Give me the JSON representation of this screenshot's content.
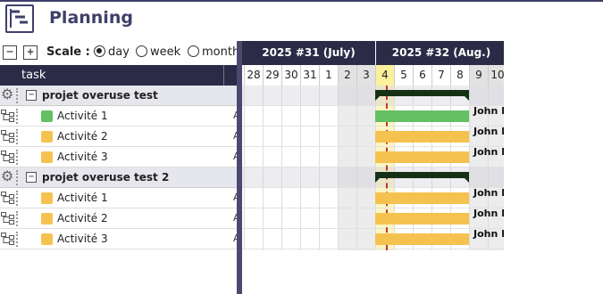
{
  "app": {
    "title": "Planning"
  },
  "toolbar": {
    "expand_minus": "−",
    "expand_plus": "+",
    "scale_label": "Scale :",
    "scale_options": [
      {
        "label": "day",
        "selected": true
      },
      {
        "label": "week",
        "selected": false
      },
      {
        "label": "month",
        "selected": false
      }
    ]
  },
  "grid": {
    "task_header": "task",
    "rows": [
      {
        "type": "group",
        "label": "projet overuse test",
        "col2": ""
      },
      {
        "type": "task",
        "label": "Activité 1",
        "color": "#63c063",
        "col2": "A"
      },
      {
        "type": "task",
        "label": "Activité 2",
        "color": "#f5c24f",
        "col2": "A"
      },
      {
        "type": "task",
        "label": "Activité 3",
        "color": "#f5c24f",
        "col2": "A"
      },
      {
        "type": "group",
        "label": "projet overuse test 2",
        "col2": ""
      },
      {
        "type": "task",
        "label": "Activité 1",
        "color": "#f5c24f",
        "col2": "A"
      },
      {
        "type": "task",
        "label": "Activité 2",
        "color": "#f5c24f",
        "col2": "A"
      },
      {
        "type": "task",
        "label": "Activité 3",
        "color": "#f5c24f",
        "col2": "A"
      }
    ]
  },
  "timeline": {
    "weeks": [
      {
        "label": "2025 #31 (July)"
      },
      {
        "label": "2025 #32 (Aug.)"
      }
    ],
    "days": [
      "28",
      "29",
      "30",
      "31",
      "1",
      "2",
      "3",
      "4",
      "5",
      "6",
      "7",
      "8",
      "9",
      "10"
    ],
    "weekend_days": [
      "2",
      "3",
      "9",
      "10"
    ],
    "today": "4",
    "resource": "John Doe"
  },
  "colors": {
    "header_bg": "#2b2b47",
    "title": "#3f3f6a",
    "green_bar": "#63c063",
    "orange_bar": "#f5c24f",
    "summary_bar": "#163016",
    "today_line": "#c0392b"
  }
}
